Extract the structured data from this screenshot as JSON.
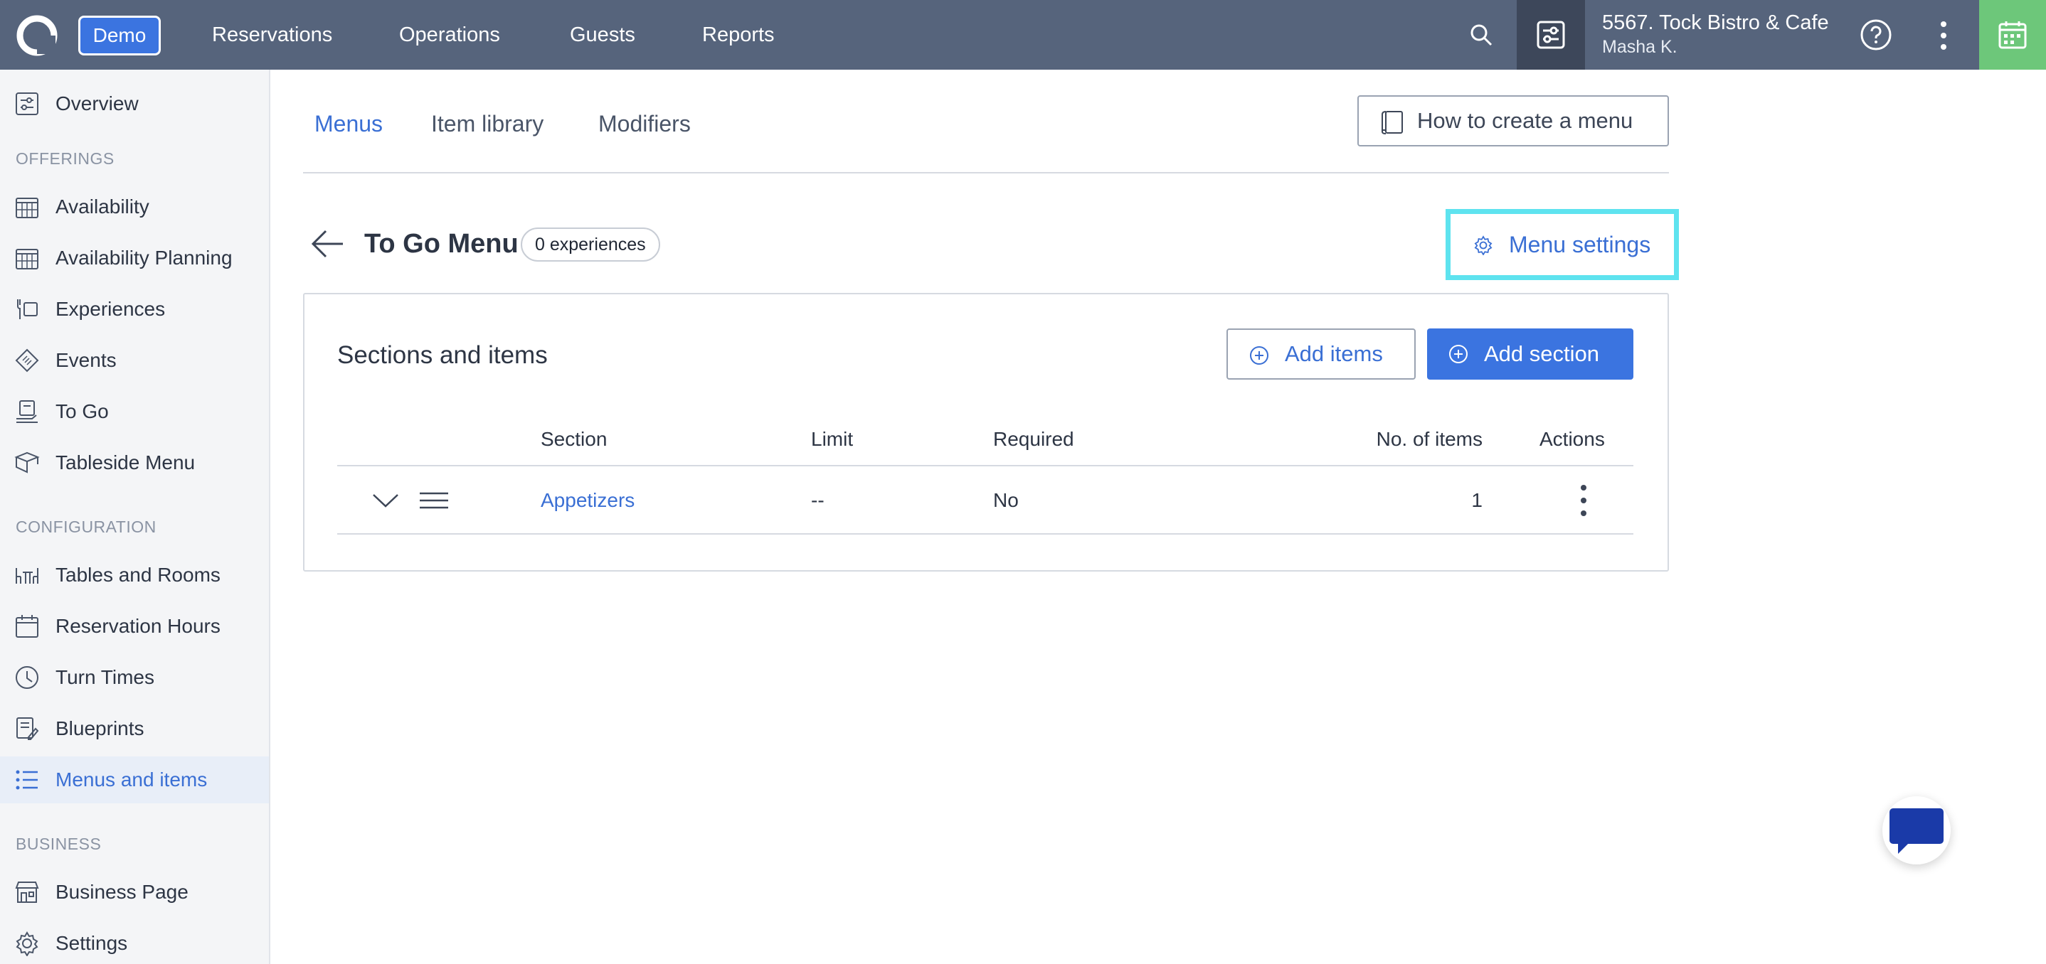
{
  "topbar": {
    "demo_label": "Demo",
    "nav": [
      "Reservations",
      "Operations",
      "Guests",
      "Reports"
    ],
    "venue_name": "5567. Tock Bistro & Cafe",
    "venue_user": "Masha K."
  },
  "sidebar": {
    "overview": "Overview",
    "offerings_heading": "OFFERINGS",
    "offerings": [
      "Availability",
      "Availability Planning",
      "Experiences",
      "Events",
      "To Go",
      "Tableside Menu"
    ],
    "configuration_heading": "CONFIGURATION",
    "configuration": [
      "Tables and Rooms",
      "Reservation Hours",
      "Turn Times",
      "Blueprints",
      "Menus and items"
    ],
    "business_heading": "BUSINESS",
    "business": [
      "Business Page",
      "Settings"
    ],
    "active_item": "Menus and items"
  },
  "tabs": [
    {
      "label": "Menus",
      "active": true
    },
    {
      "label": "Item library",
      "active": false
    },
    {
      "label": "Modifiers",
      "active": false
    }
  ],
  "how_to_label": "How to create a menu",
  "page": {
    "title": "To Go Menu",
    "experiences_badge": "0 experiences",
    "menu_settings_label": "Menu settings"
  },
  "card": {
    "title": "Sections and items",
    "add_items_label": "Add items",
    "add_section_label": "Add section",
    "columns": [
      "Section",
      "Limit",
      "Required",
      "No. of items",
      "Actions"
    ],
    "rows": [
      {
        "section": "Appetizers",
        "limit": "--",
        "required": "No",
        "items": "1"
      }
    ]
  },
  "colors": {
    "topbar": "#56647c",
    "accent": "#3b74e0",
    "highlight": "#5ee3ef",
    "calendar": "#6dc77a"
  }
}
